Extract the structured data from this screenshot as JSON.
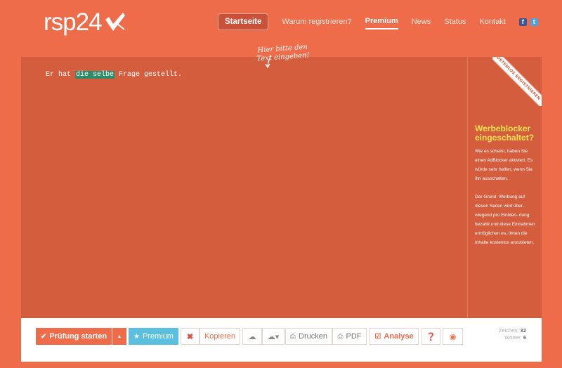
{
  "logo": {
    "text": "rsp24"
  },
  "nav": {
    "items": [
      "Startseite",
      "Warum registrieren?",
      "Premium",
      "News",
      "Status",
      "Kontakt"
    ],
    "social": [
      "f",
      "t"
    ]
  },
  "editor": {
    "text_before": "Er hat ",
    "highlight": "die selbe",
    "text_after": " Frage gestellt.",
    "hint_line1": "Hier bitte den",
    "hint_line2": "Text eingeben!",
    "ribbon": "KOSTENLOS REGISTRIEREN"
  },
  "sidebar": {
    "title": "Werbeblocker eingeschaltet?",
    "p1": "Wie es scheint, haben Sie einen AdBlocker aktiviert. Es würde sehr helfen, wenn Sie ihn ausschalten.",
    "p2": "Der Grund: Werbung auf diesen Seiten wird über- wiegend pro Einblen- dung bezahlt und diese Einnahmen ermöglichen es, Ihnen die Inhalte kostenlos anzubieten."
  },
  "toolbar": {
    "start": "Prüfung starten",
    "premium": "Premium",
    "copy": "Kopieren",
    "print": "Drucken",
    "pdf": "PDF",
    "analyse": "Analyse",
    "chars_label": "Zeichen:",
    "chars_value": "32",
    "words_label": "Wörter:",
    "words_value": "6"
  },
  "icons": {
    "check": "check-icon",
    "star": "star-icon",
    "x": "x-icon",
    "upload": "cloud-upload-icon",
    "download": "cloud-download-icon",
    "print": "print-icon",
    "pdf": "pdf-icon",
    "help": "help-icon",
    "eye": "eye-slash-icon"
  },
  "colors": {
    "background": "#ef6c4a",
    "editor": "#d45d3e",
    "highlight": "#2e8b6a",
    "sidebar_title": "#ffe24d",
    "blue_button": "#5bc0de"
  }
}
